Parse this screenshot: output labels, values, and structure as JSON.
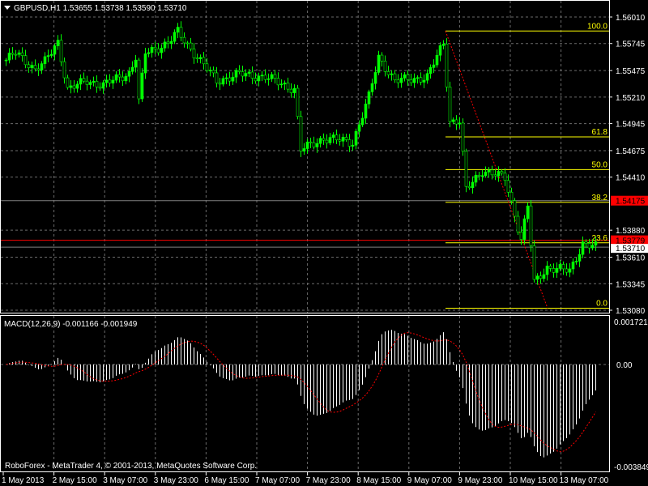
{
  "window": {
    "symbol_header": "GBPUSD,H1  1.53655 1.53738 1.53590 1.53710",
    "watermark": "RoboForex - MetaTrader 4, © 2001-2013, MetaQuotes Software Corp."
  },
  "colors": {
    "background": "#000000",
    "candle": "#00ff00",
    "grid": "#6c6c6c",
    "fibo": "#ffff00",
    "red_line": "#ff0000",
    "macd_hist": "#ffffff",
    "macd_signal": "#ff0000"
  },
  "price_axis": {
    "labels": [
      "1.56010",
      "1.55745",
      "1.55475",
      "1.55210",
      "1.54945",
      "1.54675",
      "1.54410",
      "1.53880",
      "1.53610",
      "1.53345",
      "1.53080"
    ],
    "red_level_1": "1.54175",
    "red_level_2": "1.53779",
    "bid_label": "1.53710"
  },
  "time_axis": {
    "labels": [
      "1 May 2013",
      "2 May 15:00",
      "3 May 07:00",
      "3 May 23:00",
      "6 May 15:00",
      "7 May 07:00",
      "7 May 23:00",
      "8 May 15:00",
      "9 May 07:00",
      "9 May 23:00",
      "10 May 15:00",
      "13 May 07:00"
    ]
  },
  "fibonacci": {
    "high": 1.5587,
    "low": 1.531,
    "start_bar": 136,
    "end_bar": 167,
    "levels": [
      {
        "ratio": 1.0,
        "label": "100.0"
      },
      {
        "ratio": 0.618,
        "label": "61.8"
      },
      {
        "ratio": 0.5,
        "label": "50.0"
      },
      {
        "ratio": 0.382,
        "label": "38.2"
      },
      {
        "ratio": 0.236,
        "label": "23.6"
      },
      {
        "ratio": 0.0,
        "label": "0.0"
      }
    ]
  },
  "macd": {
    "header": "MACD(12,26,9) -0.001166 -0.001949",
    "axis_top": "0.001721",
    "axis_zero": "0.00",
    "axis_bottom": "-0.003849"
  },
  "chart_data": {
    "type": "candlestick",
    "symbol": "GBPUSD",
    "timeframe": "H1",
    "ylim": [
      1.5294,
      1.5621
    ],
    "bar_count": 183,
    "price_path": [
      [
        0,
        1.5558
      ],
      [
        3,
        1.5565
      ],
      [
        9,
        1.5549
      ],
      [
        12,
        1.5556
      ],
      [
        16,
        1.5576
      ],
      [
        19,
        1.5529
      ],
      [
        25,
        1.5537
      ],
      [
        30,
        1.5533
      ],
      [
        38,
        1.5545
      ],
      [
        40,
        1.5561
      ],
      [
        41,
        1.5516
      ],
      [
        43,
        1.5565
      ],
      [
        50,
        1.5575
      ],
      [
        53,
        1.5586
      ],
      [
        59,
        1.5561
      ],
      [
        65,
        1.5537
      ],
      [
        72,
        1.5544
      ],
      [
        80,
        1.5541
      ],
      [
        89,
        1.5529
      ],
      [
        91,
        1.5468
      ],
      [
        98,
        1.548
      ],
      [
        107,
        1.5476
      ],
      [
        112,
        1.5521
      ],
      [
        115,
        1.5561
      ],
      [
        120,
        1.5537
      ],
      [
        130,
        1.5541
      ],
      [
        135,
        1.5575
      ],
      [
        137,
        1.5497
      ],
      [
        140,
        1.5497
      ],
      [
        142,
        1.5428
      ],
      [
        147,
        1.5448
      ],
      [
        154,
        1.544
      ],
      [
        159,
        1.5379
      ],
      [
        161,
        1.5412
      ],
      [
        163,
        1.5335
      ],
      [
        167,
        1.5351
      ],
      [
        174,
        1.5347
      ],
      [
        178,
        1.5375
      ],
      [
        182,
        1.5371
      ]
    ]
  }
}
